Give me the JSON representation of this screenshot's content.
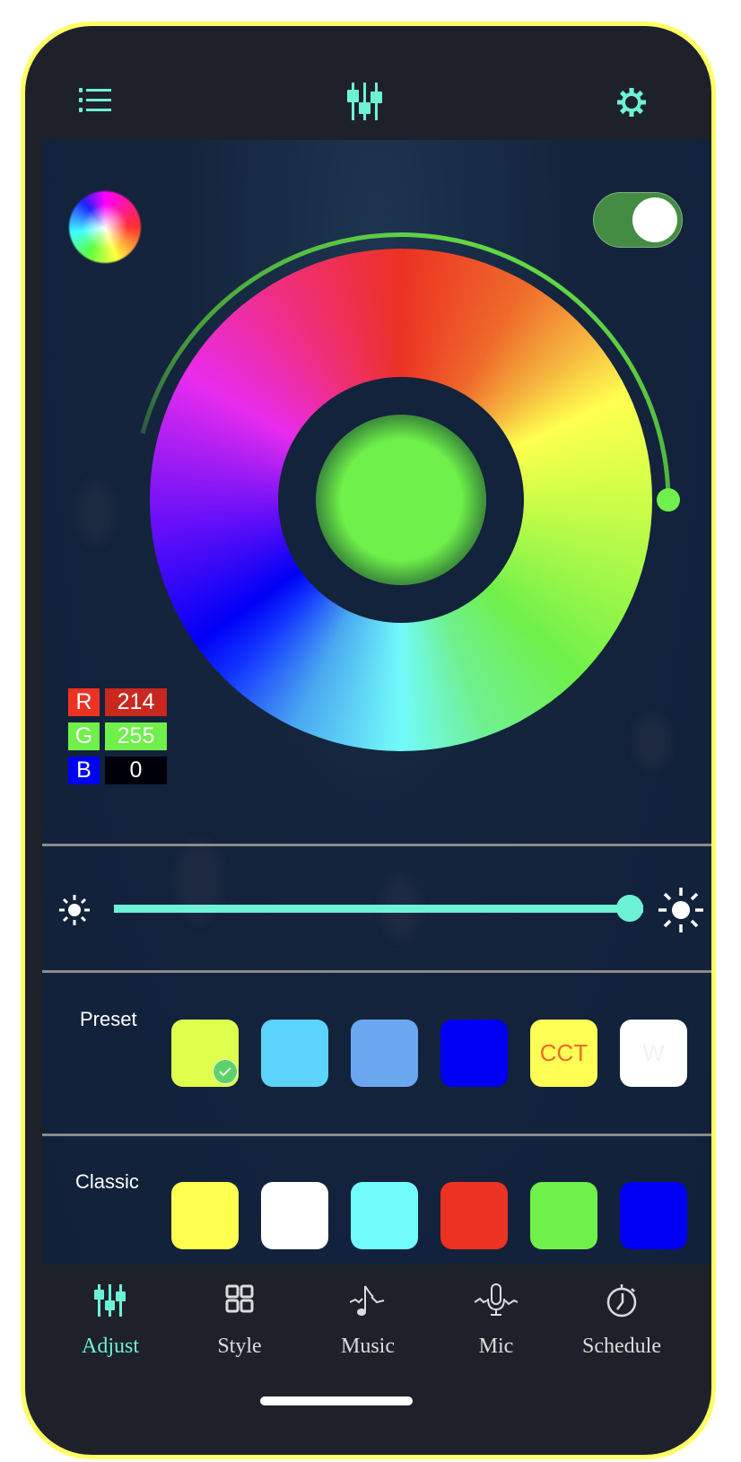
{
  "header": {
    "menu_icon": "list-icon",
    "center_icon": "sliders-icon",
    "settings_icon": "gear-icon"
  },
  "colors": {
    "accent": "#6df2d6",
    "frame_border": "#ffff66",
    "background": "#1f212a",
    "panel": "#13233b",
    "toggle_on": "#448c44",
    "arc_green": "#6ff04a",
    "selected_check": "#5fd16a"
  },
  "power_toggle": {
    "on": true
  },
  "color_wheel": {
    "selected_color": "#6ff04a",
    "hue_arc_fraction": 0.5
  },
  "rgb": {
    "r_label": "R",
    "r_value": "214",
    "g_label": "G",
    "g_value": "255",
    "b_label": "B",
    "b_value": "0"
  },
  "brightness": {
    "value_percent": 100,
    "min_icon": "sun-small-icon",
    "max_icon": "sun-large-icon"
  },
  "preset": {
    "label": "Preset",
    "swatches": [
      {
        "color": "#deff4c",
        "text": "",
        "selected": true
      },
      {
        "color": "#5cd3fa",
        "text": ""
      },
      {
        "color": "#6aa7ee",
        "text": ""
      },
      {
        "color": "#0000f5",
        "text": ""
      },
      {
        "color": "#ffff55",
        "text": "CCT",
        "text_color": "#ee6a2a"
      },
      {
        "color": "#ffffff",
        "text": "W",
        "text_color": "#f2f2f2"
      }
    ]
  },
  "classic": {
    "label": "Classic",
    "swatches": [
      {
        "color": "#ffff4f"
      },
      {
        "color": "#ffffff"
      },
      {
        "color": "#72fbfb"
      },
      {
        "color": "#ec3223"
      },
      {
        "color": "#6ff04a"
      },
      {
        "color": "#0000f5"
      }
    ]
  },
  "tabs": [
    {
      "label": "Adjust",
      "icon": "sliders-icon",
      "active": true
    },
    {
      "label": "Style",
      "icon": "grid-icon",
      "active": false
    },
    {
      "label": "Music",
      "icon": "music-note-icon",
      "active": false
    },
    {
      "label": "Mic",
      "icon": "microphone-icon",
      "active": false
    },
    {
      "label": "Schedule",
      "icon": "stopwatch-icon",
      "active": false
    }
  ]
}
